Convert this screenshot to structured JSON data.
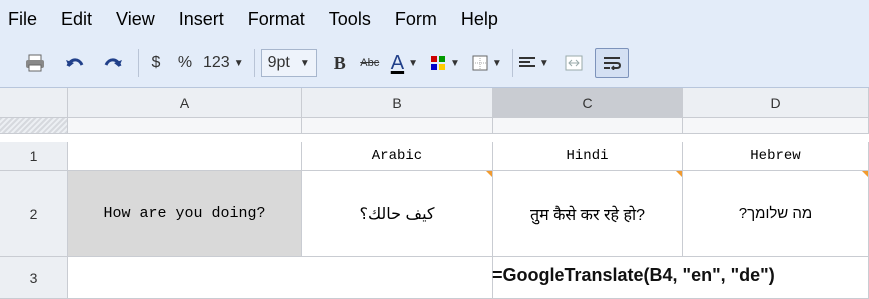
{
  "menu": [
    "File",
    "Edit",
    "View",
    "Insert",
    "Format",
    "Tools",
    "Form",
    "Help"
  ],
  "toolbar": {
    "currency": "$",
    "percent": "%",
    "number_format": "123",
    "font_size": "9pt",
    "bold": "B",
    "strikethrough": "Abc",
    "text_color": "A",
    "colors": {
      "accent": "#f29b2f",
      "bg": "#e3ecf9"
    }
  },
  "columns": [
    "A",
    "B",
    "C",
    "D"
  ],
  "rows": [
    {
      "num": "1",
      "cells": [
        "",
        "Arabic",
        "Hindi",
        "Hebrew"
      ]
    },
    {
      "num": "2",
      "cells": [
        "How are you doing?",
        "كيف حالك؟",
        "तुम कैसे कर रहे हो?",
        "?מה שלומך"
      ]
    },
    {
      "num": "3",
      "cells": [
        "",
        "",
        "",
        ""
      ]
    }
  ],
  "formula": "=GoogleTranslate(B4, \"en\", \"de\")"
}
